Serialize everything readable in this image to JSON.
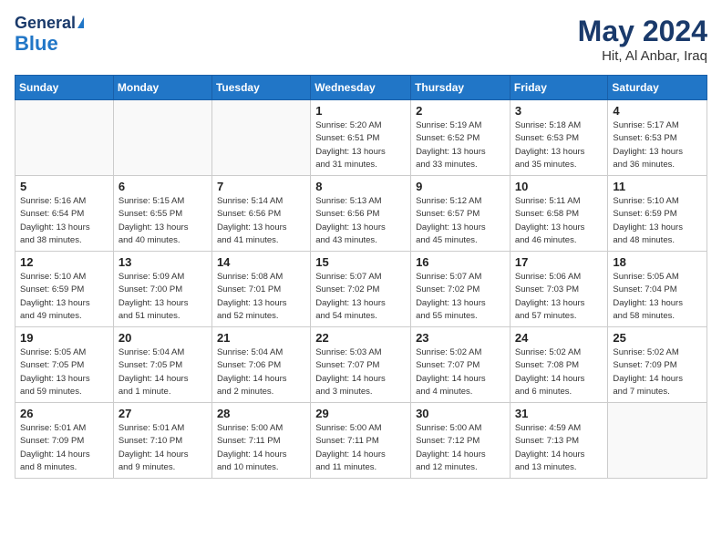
{
  "header": {
    "logo_general": "General",
    "logo_blue": "Blue",
    "title": "May 2024",
    "subtitle": "Hit, Al Anbar, Iraq"
  },
  "days_of_week": [
    "Sunday",
    "Monday",
    "Tuesday",
    "Wednesday",
    "Thursday",
    "Friday",
    "Saturday"
  ],
  "weeks": [
    [
      {
        "day": "",
        "info": ""
      },
      {
        "day": "",
        "info": ""
      },
      {
        "day": "",
        "info": ""
      },
      {
        "day": "1",
        "info": "Sunrise: 5:20 AM\nSunset: 6:51 PM\nDaylight: 13 hours\nand 31 minutes."
      },
      {
        "day": "2",
        "info": "Sunrise: 5:19 AM\nSunset: 6:52 PM\nDaylight: 13 hours\nand 33 minutes."
      },
      {
        "day": "3",
        "info": "Sunrise: 5:18 AM\nSunset: 6:53 PM\nDaylight: 13 hours\nand 35 minutes."
      },
      {
        "day": "4",
        "info": "Sunrise: 5:17 AM\nSunset: 6:53 PM\nDaylight: 13 hours\nand 36 minutes."
      }
    ],
    [
      {
        "day": "5",
        "info": "Sunrise: 5:16 AM\nSunset: 6:54 PM\nDaylight: 13 hours\nand 38 minutes."
      },
      {
        "day": "6",
        "info": "Sunrise: 5:15 AM\nSunset: 6:55 PM\nDaylight: 13 hours\nand 40 minutes."
      },
      {
        "day": "7",
        "info": "Sunrise: 5:14 AM\nSunset: 6:56 PM\nDaylight: 13 hours\nand 41 minutes."
      },
      {
        "day": "8",
        "info": "Sunrise: 5:13 AM\nSunset: 6:56 PM\nDaylight: 13 hours\nand 43 minutes."
      },
      {
        "day": "9",
        "info": "Sunrise: 5:12 AM\nSunset: 6:57 PM\nDaylight: 13 hours\nand 45 minutes."
      },
      {
        "day": "10",
        "info": "Sunrise: 5:11 AM\nSunset: 6:58 PM\nDaylight: 13 hours\nand 46 minutes."
      },
      {
        "day": "11",
        "info": "Sunrise: 5:10 AM\nSunset: 6:59 PM\nDaylight: 13 hours\nand 48 minutes."
      }
    ],
    [
      {
        "day": "12",
        "info": "Sunrise: 5:10 AM\nSunset: 6:59 PM\nDaylight: 13 hours\nand 49 minutes."
      },
      {
        "day": "13",
        "info": "Sunrise: 5:09 AM\nSunset: 7:00 PM\nDaylight: 13 hours\nand 51 minutes."
      },
      {
        "day": "14",
        "info": "Sunrise: 5:08 AM\nSunset: 7:01 PM\nDaylight: 13 hours\nand 52 minutes."
      },
      {
        "day": "15",
        "info": "Sunrise: 5:07 AM\nSunset: 7:02 PM\nDaylight: 13 hours\nand 54 minutes."
      },
      {
        "day": "16",
        "info": "Sunrise: 5:07 AM\nSunset: 7:02 PM\nDaylight: 13 hours\nand 55 minutes."
      },
      {
        "day": "17",
        "info": "Sunrise: 5:06 AM\nSunset: 7:03 PM\nDaylight: 13 hours\nand 57 minutes."
      },
      {
        "day": "18",
        "info": "Sunrise: 5:05 AM\nSunset: 7:04 PM\nDaylight: 13 hours\nand 58 minutes."
      }
    ],
    [
      {
        "day": "19",
        "info": "Sunrise: 5:05 AM\nSunset: 7:05 PM\nDaylight: 13 hours\nand 59 minutes."
      },
      {
        "day": "20",
        "info": "Sunrise: 5:04 AM\nSunset: 7:05 PM\nDaylight: 14 hours\nand 1 minute."
      },
      {
        "day": "21",
        "info": "Sunrise: 5:04 AM\nSunset: 7:06 PM\nDaylight: 14 hours\nand 2 minutes."
      },
      {
        "day": "22",
        "info": "Sunrise: 5:03 AM\nSunset: 7:07 PM\nDaylight: 14 hours\nand 3 minutes."
      },
      {
        "day": "23",
        "info": "Sunrise: 5:02 AM\nSunset: 7:07 PM\nDaylight: 14 hours\nand 4 minutes."
      },
      {
        "day": "24",
        "info": "Sunrise: 5:02 AM\nSunset: 7:08 PM\nDaylight: 14 hours\nand 6 minutes."
      },
      {
        "day": "25",
        "info": "Sunrise: 5:02 AM\nSunset: 7:09 PM\nDaylight: 14 hours\nand 7 minutes."
      }
    ],
    [
      {
        "day": "26",
        "info": "Sunrise: 5:01 AM\nSunset: 7:09 PM\nDaylight: 14 hours\nand 8 minutes."
      },
      {
        "day": "27",
        "info": "Sunrise: 5:01 AM\nSunset: 7:10 PM\nDaylight: 14 hours\nand 9 minutes."
      },
      {
        "day": "28",
        "info": "Sunrise: 5:00 AM\nSunset: 7:11 PM\nDaylight: 14 hours\nand 10 minutes."
      },
      {
        "day": "29",
        "info": "Sunrise: 5:00 AM\nSunset: 7:11 PM\nDaylight: 14 hours\nand 11 minutes."
      },
      {
        "day": "30",
        "info": "Sunrise: 5:00 AM\nSunset: 7:12 PM\nDaylight: 14 hours\nand 12 minutes."
      },
      {
        "day": "31",
        "info": "Sunrise: 4:59 AM\nSunset: 7:13 PM\nDaylight: 14 hours\nand 13 minutes."
      },
      {
        "day": "",
        "info": ""
      }
    ]
  ]
}
